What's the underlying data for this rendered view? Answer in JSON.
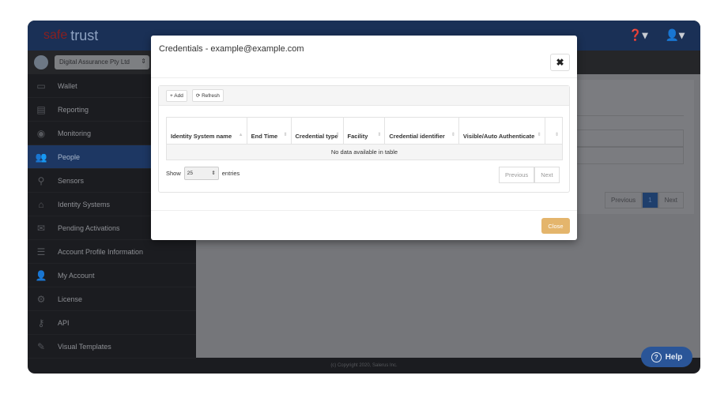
{
  "header": {
    "logo_text": "trust",
    "logo_prefix": "safe",
    "help_menu": "?",
    "user_menu": "user"
  },
  "org_selector": {
    "value": "Digital Assurance Pty Ltd"
  },
  "sidebar": {
    "items": [
      {
        "label": "Wallet",
        "icon": "wallet-icon",
        "glyph": "▭"
      },
      {
        "label": "Reporting",
        "icon": "reporting-icon",
        "glyph": "▤"
      },
      {
        "label": "Monitoring",
        "icon": "eye-icon",
        "glyph": "◉"
      },
      {
        "label": "People",
        "icon": "people-icon",
        "glyph": "👥",
        "active": true
      },
      {
        "label": "Sensors",
        "icon": "map-marker-icon",
        "glyph": "⚲"
      },
      {
        "label": "Identity Systems",
        "icon": "home-icon",
        "glyph": "⌂"
      },
      {
        "label": "Pending Activations",
        "icon": "envelope-icon",
        "glyph": "✉"
      },
      {
        "label": "Account Profile Information",
        "icon": "list-icon",
        "glyph": "☰"
      },
      {
        "label": "My Account",
        "icon": "user-icon",
        "glyph": "👤"
      },
      {
        "label": "License",
        "icon": "gear-icon",
        "glyph": "⚙"
      },
      {
        "label": "API",
        "icon": "key-icon",
        "glyph": "⚷"
      },
      {
        "label": "Visual Templates",
        "icon": "brush-icon",
        "glyph": "✎"
      }
    ]
  },
  "background": {
    "pagination": {
      "previous": "Previous",
      "current": "1",
      "next": "Next"
    }
  },
  "footer": {
    "copyright": "(c) Copyright 2020, Salerus Inc."
  },
  "help_button": {
    "label": "Help"
  },
  "modal": {
    "title": "Credentials - example@example.com",
    "close_icon": "✖",
    "toolbar": {
      "add": "+ Add",
      "refresh": "⟳ Refresh"
    },
    "table": {
      "columns": [
        "Identity System name",
        "End Time",
        "Credential type",
        "Facility",
        "Credential identifier",
        "Visible/Auto Authenticate",
        ""
      ],
      "empty_message": "No data available in table"
    },
    "length": {
      "show": "Show",
      "value": "25",
      "entries": "entries"
    },
    "pagination": {
      "previous": "Previous",
      "next": "Next"
    },
    "close_label": "Close"
  }
}
